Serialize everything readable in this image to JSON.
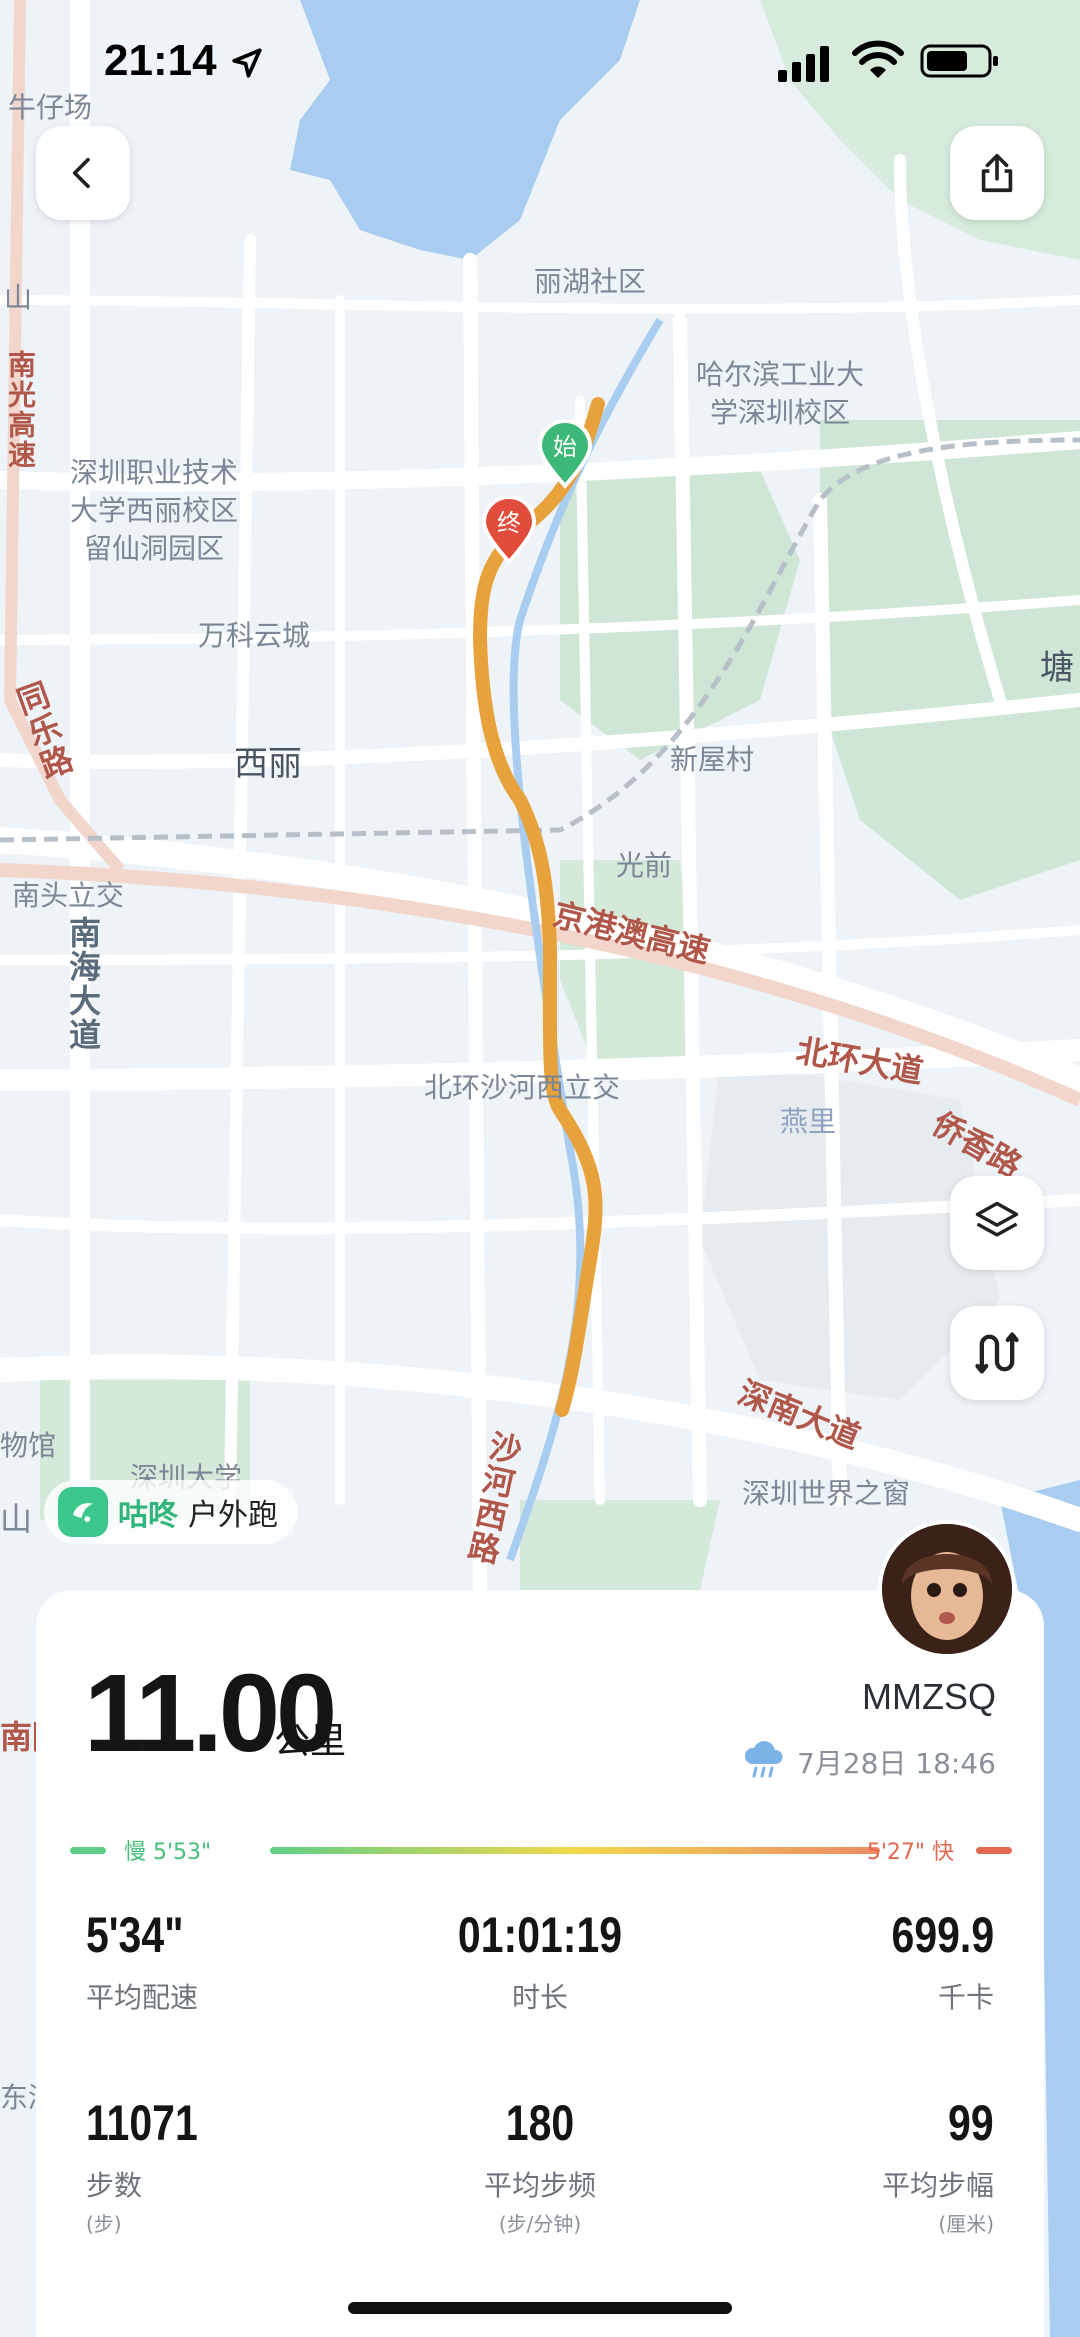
{
  "status_bar": {
    "time": "21:14"
  },
  "map_labels": [
    {
      "id": "niuzaichang",
      "text": "牛仔场"
    },
    {
      "id": "lihu",
      "text": "丽湖社区"
    },
    {
      "id": "hit",
      "text": "哈尔滨工业大\n学深圳校区"
    },
    {
      "id": "szpt",
      "text": "深圳职业技术\n大学西丽校区\n留仙洞园区"
    },
    {
      "id": "vanke",
      "text": "万科云城"
    },
    {
      "id": "xili",
      "text": "西丽"
    },
    {
      "id": "xinwu",
      "text": "新屋村"
    },
    {
      "id": "guangqian",
      "text": "光前"
    },
    {
      "id": "nantou",
      "text": "南头立交"
    },
    {
      "id": "jinggang",
      "text": "京港澳高速"
    },
    {
      "id": "beihuan_li",
      "text": "北环沙河西立交"
    },
    {
      "id": "beihuan",
      "text": "北环大道"
    },
    {
      "id": "yanli",
      "text": "燕里"
    },
    {
      "id": "qiaoxiang",
      "text": "侨香路"
    },
    {
      "id": "shennan",
      "text": "深南大道"
    },
    {
      "id": "window",
      "text": "深圳世界之窗"
    },
    {
      "id": "szu",
      "text": "深圳大学"
    },
    {
      "id": "museum",
      "text": "物馆"
    },
    {
      "id": "tang",
      "text": "塘"
    },
    {
      "id": "shan",
      "text": "山"
    },
    {
      "id": "donghai",
      "text": "东滨"
    },
    {
      "id": "nanhai_road",
      "text": "南海大道"
    },
    {
      "id": "tongle",
      "text": "同乐路"
    },
    {
      "id": "shahexi",
      "text": "沙河西路"
    },
    {
      "id": "nanguang",
      "text": "南光高速"
    },
    {
      "id": "left_edge",
      "text": "山"
    },
    {
      "id": "left_edge2",
      "text": "南隧"
    }
  ],
  "markers": {
    "start": "始",
    "end": "终"
  },
  "brand": {
    "name": "咕咚",
    "activity": "户外跑"
  },
  "summary": {
    "distance": "11.00",
    "distance_unit": "公里",
    "username": "MMZSQ",
    "datetime": "7月28日 18:46",
    "slow_label": "慢 5'53\"",
    "fast_label": "5'27\" 快"
  },
  "stats": [
    {
      "value": "5'34\"",
      "label": "平均配速",
      "sub": ""
    },
    {
      "value": "01:01:19",
      "label": "时长",
      "sub": ""
    },
    {
      "value": "699.9",
      "label": "千卡",
      "sub": ""
    },
    {
      "value": "11071",
      "label": "步数",
      "sub": "(步)"
    },
    {
      "value": "180",
      "label": "平均步频",
      "sub": "(步/分钟)"
    },
    {
      "value": "99",
      "label": "平均步幅",
      "sub": "(厘米)"
    }
  ],
  "colors": {
    "route": "#e8a23c",
    "accent": "#2fb67a",
    "slow": "#46c07a",
    "fast": "#e0694f"
  }
}
